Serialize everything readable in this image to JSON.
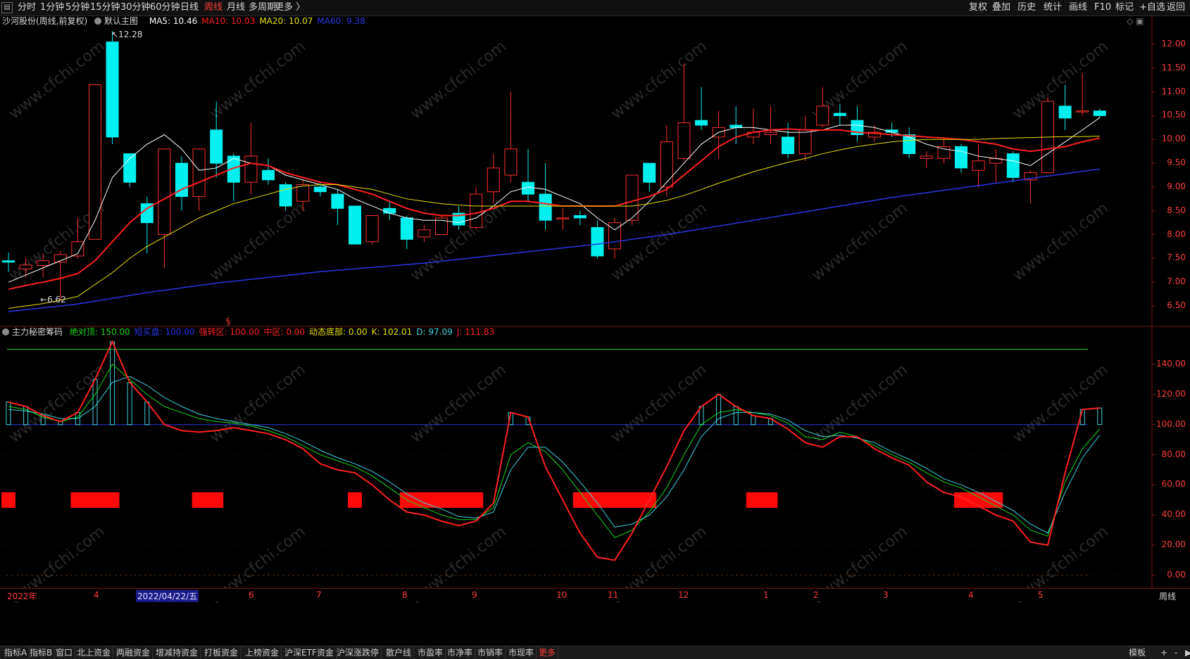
{
  "toolbar": {
    "periods": [
      "分时",
      "1分钟",
      "5分钟",
      "15分钟",
      "30分钟",
      "60分钟",
      "日线",
      "周线",
      "月线",
      "多周期",
      "更多 〉"
    ],
    "active_period": "周线",
    "right_buttons": [
      "复权",
      "叠加",
      "历史",
      "统计",
      "画线",
      "F10",
      "标记",
      "+自选",
      "返回"
    ]
  },
  "main_chart": {
    "stock_title": "沙河股份(周线,前复权)",
    "template_label": "默认主图",
    "ma_legend": [
      {
        "label": "MA5: 10.46",
        "color": "#ffffff"
      },
      {
        "label": "MA10: 10.03",
        "color": "#ff2020"
      },
      {
        "label": "MA20: 10.07",
        "color": "#e8e000"
      },
      {
        "label": "MA60: 9.38",
        "color": "#2b36e6"
      }
    ],
    "high_marker": "12.28",
    "low_marker": "6.62",
    "y_ticks": [
      "12.00",
      "11.50",
      "11.00",
      "10.50",
      "10.00",
      "9.50",
      "9.00",
      "8.50",
      "8.00",
      "7.50",
      "7.00",
      "6.50"
    ]
  },
  "indicator": {
    "name": "主力秘密筹码",
    "params": [
      {
        "label": "绝对顶: 150.00",
        "color": "#19d619"
      },
      {
        "label": "短买盘: 100.00",
        "color": "#2b36e6"
      },
      {
        "label": "强转区: 100.00",
        "color": "#ff2020"
      },
      {
        "label": "中区: 0.00",
        "color": "#ff2020"
      },
      {
        "label": "动态底部: 0.00",
        "color": "#e8e000"
      },
      {
        "label": "K: 102.01",
        "color": "#e8e000"
      },
      {
        "label": "D: 97.09",
        "color": "#3fd3e0"
      },
      {
        "label": "J: 111.83",
        "color": "#ff2020"
      }
    ],
    "y_ticks": [
      "140.00",
      "120.00",
      "100.00",
      "80.00",
      "60.00",
      "40.00",
      "20.00",
      "0.00"
    ]
  },
  "date_axis": [
    "2022年",
    "4",
    "2022/04/22/五",
    "6",
    "7",
    "8",
    "9",
    "10",
    "11",
    "12",
    "1",
    "2",
    "3",
    "4",
    "5"
  ],
  "date_axis_right": "周线",
  "bottom_tabs": [
    "指标A",
    "指标B",
    "窗口",
    "北上资金",
    "两融资金",
    "增减持资金",
    "打板资金",
    "上榜资金",
    "沪深ETF资金",
    "沪深涨跌停",
    "散户线",
    "市盈率",
    "市净率",
    "市销率",
    "市现率",
    "更多"
  ],
  "active_tab": "更多",
  "bottom_right": [
    "模板",
    "+",
    "-",
    "▶"
  ],
  "watermark": "www.cfchi.com",
  "chart_data": [
    {
      "type": "candlestick",
      "title": "沙河股份(周线,前复权)",
      "ylim": [
        6.2,
        12.4
      ],
      "candles": [
        [
          7.45,
          7.42,
          7.62,
          7.22
        ],
        [
          7.28,
          7.36,
          7.5,
          7.1
        ],
        [
          7.35,
          7.45,
          7.6,
          7.1
        ],
        [
          7.42,
          7.58,
          7.65,
          6.62
        ],
        [
          7.55,
          7.85,
          8.35,
          7.5
        ],
        [
          7.9,
          11.15,
          11.15,
          7.9
        ],
        [
          12.05,
          10.05,
          12.28,
          9.9
        ],
        [
          9.7,
          9.1,
          9.7,
          9.0
        ],
        [
          8.65,
          8.25,
          8.8,
          7.6
        ],
        [
          8.0,
          9.8,
          9.8,
          7.3
        ],
        [
          9.5,
          8.8,
          9.65,
          8.5
        ],
        [
          8.8,
          9.8,
          9.8,
          8.5
        ],
        [
          10.2,
          9.5,
          10.8,
          9.2
        ],
        [
          9.65,
          9.1,
          9.7,
          8.7
        ],
        [
          9.1,
          9.65,
          10.35,
          8.85
        ],
        [
          9.35,
          9.15,
          9.6,
          9.05
        ],
        [
          9.05,
          8.6,
          9.1,
          8.5
        ],
        [
          8.7,
          9.05,
          9.15,
          8.5
        ],
        [
          9.0,
          8.9,
          9.1,
          8.8
        ],
        [
          8.85,
          8.55,
          8.95,
          8.2
        ],
        [
          8.6,
          7.8,
          8.6,
          7.8
        ],
        [
          7.85,
          8.4,
          8.4,
          7.8
        ],
        [
          8.55,
          8.45,
          8.7,
          8.3
        ],
        [
          8.35,
          7.9,
          8.4,
          7.7
        ],
        [
          7.95,
          8.1,
          8.2,
          7.85
        ],
        [
          8.0,
          8.35,
          8.4,
          8.0
        ],
        [
          8.45,
          8.2,
          8.6,
          8.1
        ],
        [
          8.15,
          8.85,
          9.0,
          8.1
        ],
        [
          8.9,
          9.4,
          9.7,
          8.65
        ],
        [
          9.25,
          9.8,
          11.0,
          9.1
        ],
        [
          9.1,
          8.85,
          9.8,
          8.7
        ],
        [
          8.85,
          8.3,
          9.5,
          8.1
        ],
        [
          8.35,
          8.35,
          8.55,
          8.1
        ],
        [
          8.4,
          8.35,
          8.5,
          8.2
        ],
        [
          8.15,
          7.55,
          8.3,
          7.5
        ],
        [
          7.7,
          8.25,
          8.35,
          7.5
        ],
        [
          8.3,
          9.25,
          9.25,
          8.2
        ],
        [
          9.5,
          9.1,
          9.5,
          8.9
        ],
        [
          9.0,
          9.95,
          10.3,
          8.8
        ],
        [
          9.6,
          10.35,
          11.6,
          9.55
        ],
        [
          10.4,
          10.3,
          11.1,
          10.2
        ],
        [
          10.05,
          10.25,
          10.6,
          9.6
        ],
        [
          10.3,
          10.25,
          10.7,
          9.9
        ],
        [
          10.05,
          10.15,
          10.65,
          9.9
        ],
        [
          10.1,
          10.15,
          10.7,
          9.9
        ],
        [
          10.05,
          9.7,
          10.35,
          9.6
        ],
        [
          9.7,
          10.2,
          10.5,
          9.55
        ],
        [
          10.3,
          10.7,
          11.1,
          10.25
        ],
        [
          10.55,
          10.5,
          10.75,
          10.3
        ],
        [
          10.4,
          10.1,
          10.7,
          9.95
        ],
        [
          10.05,
          10.15,
          10.3,
          9.95
        ],
        [
          10.2,
          10.15,
          10.35,
          10.05
        ],
        [
          10.1,
          9.7,
          10.25,
          9.6
        ],
        [
          9.6,
          9.65,
          9.75,
          9.4
        ],
        [
          9.6,
          9.85,
          10.0,
          9.5
        ],
        [
          9.85,
          9.4,
          9.9,
          9.3
        ],
        [
          9.35,
          9.55,
          9.9,
          9.0
        ],
        [
          9.5,
          9.6,
          9.8,
          9.1
        ],
        [
          9.7,
          9.2,
          9.75,
          9.1
        ],
        [
          9.15,
          9.3,
          9.35,
          8.65
        ],
        [
          9.3,
          10.8,
          10.9,
          9.3
        ],
        [
          10.7,
          10.45,
          11.15,
          10.2
        ],
        [
          10.6,
          10.6,
          11.4,
          10.5
        ],
        [
          10.6,
          10.5,
          10.65,
          10.45
        ]
      ],
      "series": [
        {
          "name": "MA5",
          "values": [
            7.0,
            7.15,
            7.3,
            7.45,
            7.6,
            8.3,
            9.2,
            9.6,
            9.9,
            10.1,
            9.8,
            9.35,
            9.4,
            9.6,
            9.5,
            9.45,
            9.25,
            9.15,
            9.05,
            8.95,
            8.75,
            8.6,
            8.45,
            8.35,
            8.3,
            8.3,
            8.25,
            8.35,
            8.6,
            8.9,
            9.0,
            8.95,
            8.8,
            8.65,
            8.35,
            8.1,
            8.35,
            8.7,
            9.1,
            9.5,
            9.9,
            10.15,
            10.25,
            10.25,
            10.2,
            10.15,
            10.15,
            10.2,
            10.3,
            10.3,
            10.25,
            10.15,
            10.05,
            9.9,
            9.8,
            9.75,
            9.65,
            9.6,
            9.55,
            9.45,
            9.7,
            9.95,
            10.2,
            10.46
          ]
        },
        {
          "name": "MA10",
          "values": [
            6.85,
            6.93,
            7.0,
            7.08,
            7.18,
            7.45,
            7.85,
            8.25,
            8.55,
            8.75,
            8.95,
            9.1,
            9.25,
            9.4,
            9.5,
            9.45,
            9.3,
            9.2,
            9.1,
            9.05,
            8.95,
            8.85,
            8.7,
            8.55,
            8.45,
            8.4,
            8.4,
            8.45,
            8.55,
            8.7,
            8.7,
            8.65,
            8.6,
            8.6,
            8.6,
            8.6,
            8.7,
            8.8,
            8.95,
            9.25,
            9.55,
            9.85,
            10.05,
            10.15,
            10.2,
            10.22,
            10.2,
            10.2,
            10.2,
            10.15,
            10.13,
            10.1,
            10.08,
            10.05,
            10.03,
            10.0,
            9.95,
            9.9,
            9.8,
            9.75,
            9.8,
            9.85,
            9.95,
            10.03
          ]
        },
        {
          "name": "MA20",
          "values": [
            6.45,
            6.5,
            6.55,
            6.62,
            6.7,
            6.95,
            7.2,
            7.5,
            7.75,
            7.95,
            8.15,
            8.35,
            8.5,
            8.65,
            8.75,
            8.85,
            8.95,
            9.02,
            9.05,
            9.05,
            9.0,
            8.95,
            8.85,
            8.75,
            8.7,
            8.65,
            8.62,
            8.6,
            8.6,
            8.6,
            8.6,
            8.6,
            8.6,
            8.6,
            8.6,
            8.6,
            8.6,
            8.65,
            8.72,
            8.82,
            8.95,
            9.08,
            9.2,
            9.32,
            9.42,
            9.52,
            9.6,
            9.7,
            9.78,
            9.85,
            9.9,
            9.95,
            9.98,
            10.0,
            10.0,
            10.0,
            10.0,
            10.02,
            10.03,
            10.04,
            10.05,
            10.06,
            10.06,
            10.07
          ]
        },
        {
          "name": "MA60",
          "values": [
            6.38,
            6.42,
            6.46,
            6.5,
            6.54,
            6.6,
            6.66,
            6.72,
            6.78,
            6.83,
            6.88,
            6.93,
            6.98,
            7.02,
            7.06,
            7.1,
            7.14,
            7.18,
            7.22,
            7.25,
            7.28,
            7.31,
            7.34,
            7.37,
            7.4,
            7.44,
            7.48,
            7.52,
            7.56,
            7.6,
            7.64,
            7.68,
            7.72,
            7.76,
            7.8,
            7.85,
            7.9,
            7.95,
            8.0,
            8.06,
            8.12,
            8.18,
            8.24,
            8.3,
            8.36,
            8.42,
            8.48,
            8.54,
            8.6,
            8.66,
            8.72,
            8.78,
            8.83,
            8.88,
            8.93,
            8.98,
            9.03,
            9.08,
            9.13,
            9.18,
            9.23,
            9.28,
            9.33,
            9.38
          ]
        }
      ]
    },
    {
      "type": "line",
      "title": "主力秘密筹码",
      "ylim": [
        -10,
        155
      ],
      "hlines": [
        150,
        100,
        0
      ],
      "series": [
        {
          "name": "K",
          "values": [
            112,
            110,
            105,
            102,
            105,
            120,
            140,
            130,
            120,
            112,
            108,
            104,
            102,
            101,
            99,
            96,
            92,
            86,
            80,
            76,
            72,
            66,
            58,
            50,
            45,
            40,
            37,
            37,
            45,
            80,
            88,
            82,
            70,
            55,
            40,
            25,
            30,
            42,
            58,
            80,
            100,
            108,
            110,
            108,
            106,
            101,
            92,
            90,
            95,
            92,
            86,
            80,
            75,
            68,
            62,
            58,
            52,
            46,
            40,
            30,
            26,
            62,
            84,
            97
          ]
        },
        {
          "name": "D",
          "values": [
            110,
            109,
            107,
            104,
            104,
            112,
            128,
            132,
            126,
            118,
            112,
            107,
            104,
            102,
            100,
            98,
            94,
            89,
            83,
            78,
            74,
            69,
            62,
            54,
            48,
            44,
            39,
            38,
            42,
            70,
            85,
            85,
            75,
            62,
            48,
            32,
            34,
            40,
            52,
            70,
            92,
            104,
            108,
            108,
            107,
            103,
            96,
            92,
            93,
            91,
            88,
            82,
            77,
            71,
            64,
            60,
            55,
            49,
            43,
            34,
            28,
            55,
            78,
            93
          ]
        },
        {
          "name": "J",
          "values": [
            115,
            112,
            106,
            102,
            108,
            130,
            155,
            128,
            115,
            100,
            96,
            95,
            96,
            98,
            96,
            94,
            90,
            84,
            74,
            70,
            68,
            60,
            50,
            42,
            40,
            36,
            33,
            36,
            48,
            108,
            105,
            72,
            50,
            28,
            12,
            10,
            28,
            50,
            72,
            96,
            112,
            120,
            112,
            106,
            104,
            97,
            88,
            85,
            92,
            92,
            84,
            78,
            73,
            62,
            55,
            52,
            46,
            40,
            36,
            22,
            20,
            68,
            110,
            111
          ]
        }
      ]
    }
  ]
}
